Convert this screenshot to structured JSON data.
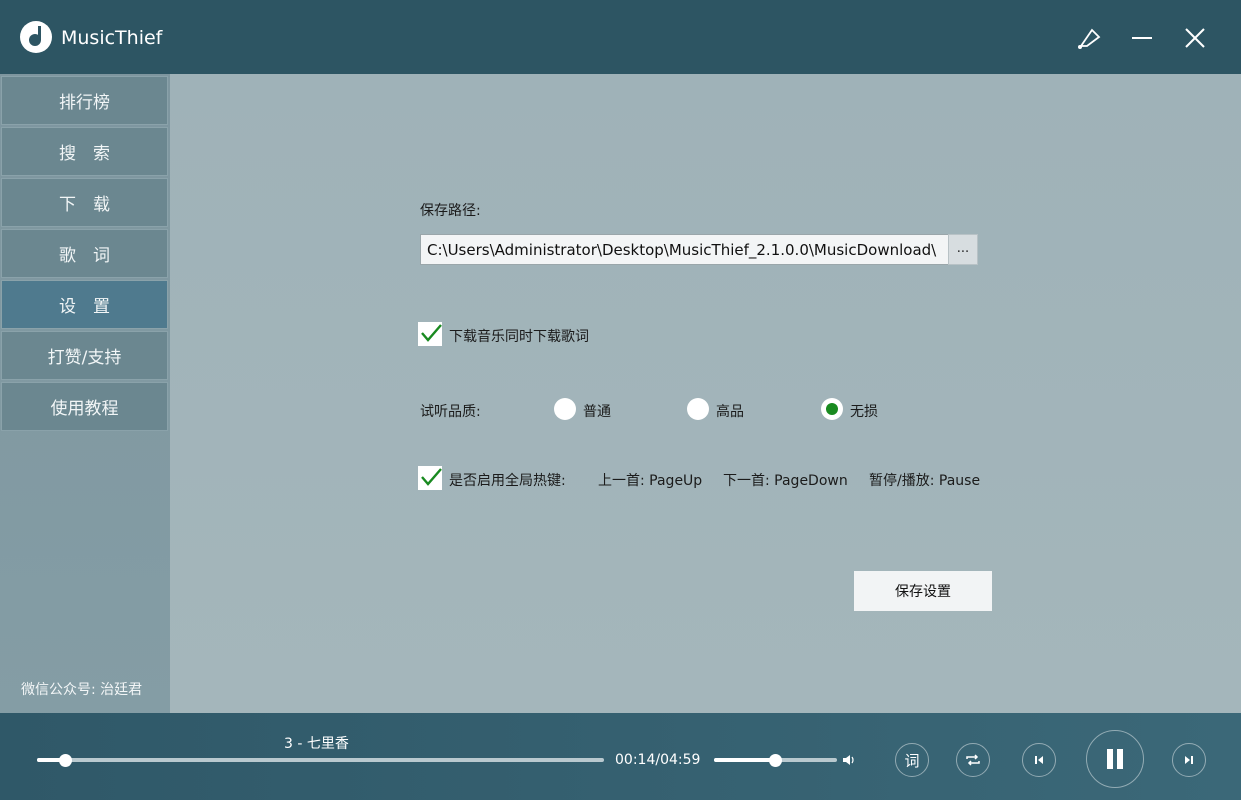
{
  "app": {
    "title": "MusicThief"
  },
  "sidebar": {
    "items": [
      {
        "label": "排行榜",
        "active": false
      },
      {
        "label": "搜　索",
        "active": false
      },
      {
        "label": "下　载",
        "active": false
      },
      {
        "label": "歌　词",
        "active": false
      },
      {
        "label": "设　置",
        "active": true
      },
      {
        "label": "打赞/支持",
        "active": false
      },
      {
        "label": "使用教程",
        "active": false
      }
    ],
    "footer": "微信公众号: 治廷君"
  },
  "settings": {
    "save_path_label": "保存路径:",
    "save_path_value": "C:\\Users\\Administrator\\Desktop\\MusicThief_2.1.0.0\\MusicDownload\\",
    "browse_label": "...",
    "lyrics_checkbox_label": "下载音乐同时下载歌词",
    "lyrics_checked": true,
    "quality_label": "试听品质:",
    "quality_options": [
      "普通",
      "高品",
      "无损"
    ],
    "quality_selected": "无损",
    "hotkey_checkbox_label": "是否启用全局热键:",
    "hotkey_checked": true,
    "hotkey_prev": "上一首: PageUp",
    "hotkey_next": "下一首: PageDown",
    "hotkey_pause": "暂停/播放: Pause",
    "save_button": "保存设置"
  },
  "player": {
    "song": "3 - 七里香",
    "time": "00:14/04:59",
    "progress": 0.05,
    "volume": 0.5,
    "lyrics_button": "词"
  },
  "colors": {
    "titlebar": "#2d5563",
    "active_nav": "#4f7a8e",
    "check_green": "#198a20"
  }
}
